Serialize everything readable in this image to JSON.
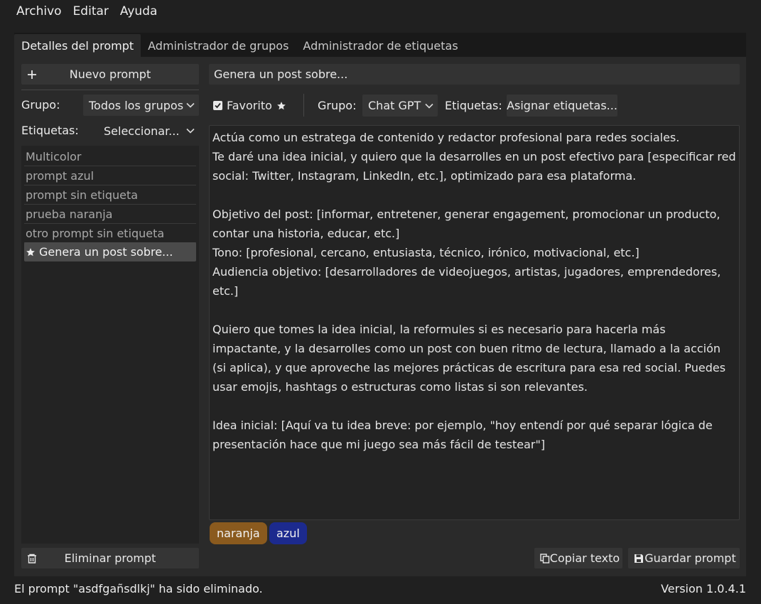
{
  "menu": [
    "Archivo",
    "Editar",
    "Ayuda"
  ],
  "tabs": [
    {
      "label": "Detalles del prompt",
      "active": true
    },
    {
      "label": "Administrador de grupos",
      "active": false
    },
    {
      "label": "Administrador de etiquetas",
      "active": false
    }
  ],
  "sidebar": {
    "new_prompt": "Nuevo prompt",
    "group_label": "Grupo:",
    "group_value": "Todos los grupos",
    "tags_label": "Etiquetas:",
    "tags_value": "Seleccionar...",
    "items": [
      {
        "label": "Multicolor",
        "selected": false
      },
      {
        "label": "prompt azul",
        "selected": false
      },
      {
        "label": "prompt sin etiqueta",
        "selected": false
      },
      {
        "label": "prueba naranja",
        "selected": false
      },
      {
        "label": "otro prompt sin etiqueta",
        "selected": false
      },
      {
        "label": "Genera un post sobre...",
        "selected": true,
        "icon": "star-icon"
      }
    ],
    "delete_prompt": "Eliminar prompt"
  },
  "details": {
    "title_value": "Genera un post sobre...",
    "favorite_label": "Favorito",
    "favorite_checked": true,
    "group_label": "Grupo:",
    "group_value": "Chat GPT",
    "tags_label": "Etiquetas:",
    "assign_tags": "Asignar etiquetas...",
    "body": "Actúa como un estratega de contenido y redactor profesional para redes sociales.\nTe daré una idea inicial, y quiero que la desarrolles en un post efectivo para [especificar red social: Twitter, Instagram, LinkedIn, etc.], optimizado para esa plataforma.\n\nObjetivo del post: [informar, entretener, generar engagement, promocionar un producto, contar una historia, educar, etc.]\nTono: [profesional, cercano, entusiasta, técnico, irónico, motivacional, etc.]\nAudiencia objetivo: [desarrolladores de videojuegos, artistas, jugadores, emprendedores, etc.]\n\nQuiero que tomes la idea inicial, la reformules si es necesario para hacerla más impactante, y la desarrolles como un post con buen ritmo de lectura, llamado a la acción (si aplica), y que aproveche las mejores prácticas de escritura para esa red social. Puedes usar emojis, hashtags o estructuras como listas si son relevantes.\n\nIdea inicial: [Aquí va tu idea breve: por ejemplo, \"hoy entendí por qué separar lógica de presentación hace que mi juego sea más fácil de testear\"]",
    "tags": [
      {
        "label": "naranja",
        "color": "#8a5a1e"
      },
      {
        "label": "azul",
        "color": "#1c2a8e"
      }
    ],
    "copy_text": "Copiar texto",
    "save_prompt": "Guardar prompt"
  },
  "status": {
    "message": "El prompt \"asdfgañsdlkj\" ha sido eliminado.",
    "version": "Version 1.0.4.1"
  },
  "colors": {
    "background": "#202020",
    "panel": "#2a2a2a",
    "selected_item": "#4a4a4a"
  }
}
